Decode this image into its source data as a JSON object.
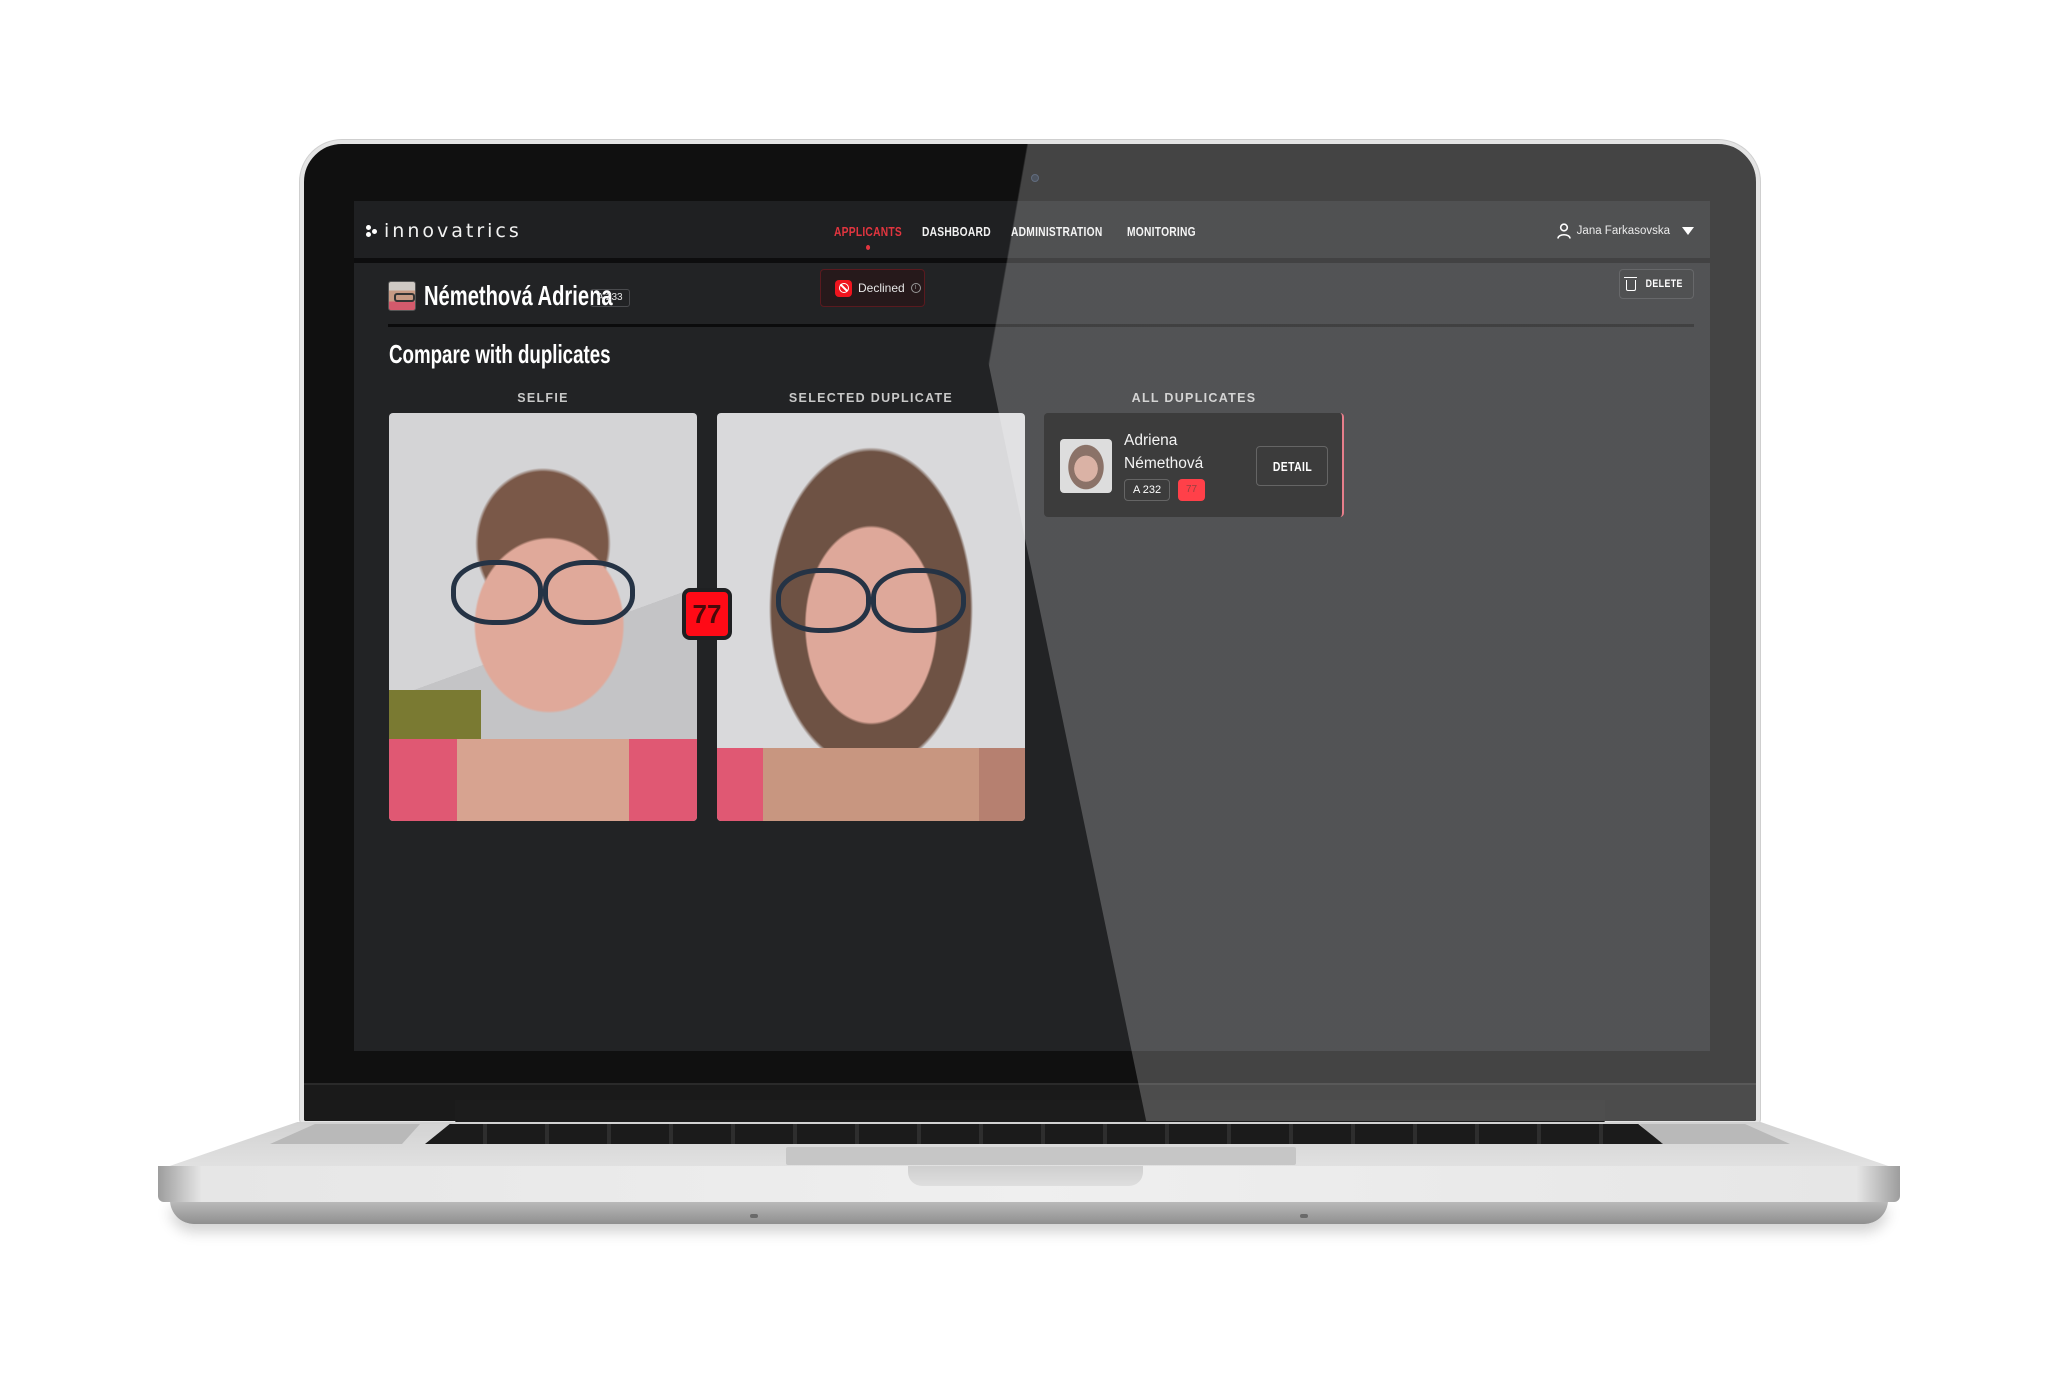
{
  "app": {
    "brand": "innovatrics",
    "nav": [
      {
        "label": "APPLICANTS",
        "active": true
      },
      {
        "label": "DASHBOARD",
        "active": false
      },
      {
        "label": "ADMINISTRATION",
        "active": false
      },
      {
        "label": "MONITORING",
        "active": false
      }
    ],
    "user": {
      "name": "Jana Farkasovska",
      "icon": "user-icon",
      "menu_icon": "caret-down-icon"
    }
  },
  "applicant": {
    "name": "Némethová Adriena",
    "id_badge": "A 233",
    "status": {
      "label": "Declined",
      "icon": "block-icon",
      "info_icon": "info-icon",
      "color": "#f0141e"
    },
    "delete_label": "DELETE"
  },
  "section": {
    "title": "Compare with duplicates",
    "columns": {
      "selfie": "SELFIE",
      "selected": "SELECTED DUPLICATE",
      "all": "ALL DUPLICATES"
    },
    "match_score": "77"
  },
  "duplicates": [
    {
      "first_name": "Adriena",
      "last_name": "Némethová",
      "id_badge": "A 232",
      "score": "77",
      "detail_label": "DETAIL"
    }
  ],
  "colors": {
    "accent": "#e2353f",
    "score_red": "#ff0a16",
    "background": "#222325"
  }
}
